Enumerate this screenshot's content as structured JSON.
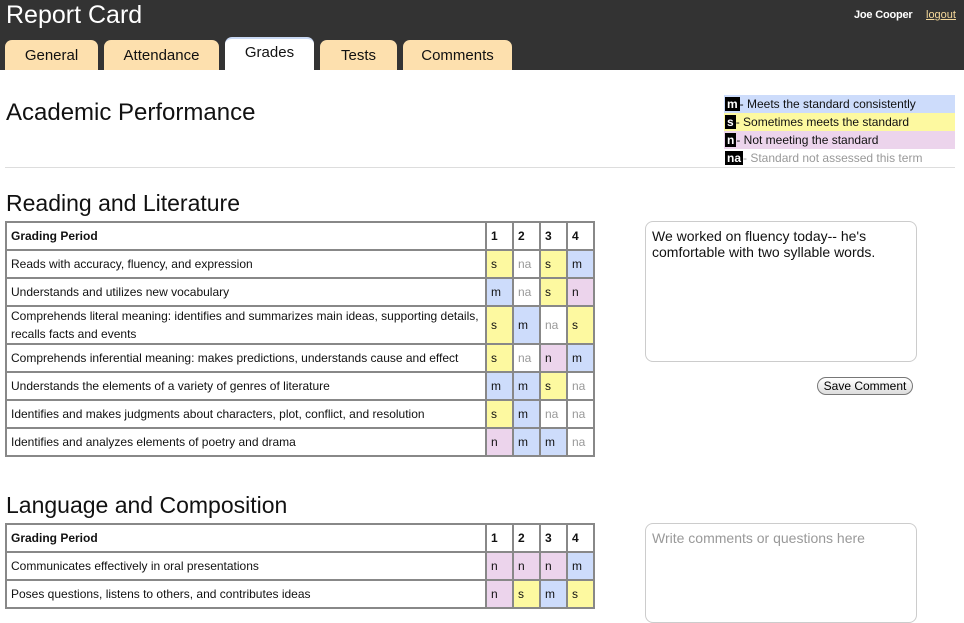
{
  "app": {
    "title": "Report Card",
    "user": "Joe Cooper",
    "logout": "logout"
  },
  "tabs": [
    {
      "label": "General",
      "w": 93
    },
    {
      "label": "Attendance",
      "w": 115
    },
    {
      "label": "Grades",
      "w": 89,
      "active": true
    },
    {
      "label": "Tests",
      "w": 77
    },
    {
      "label": "Comments",
      "w": 109
    }
  ],
  "page_title": "Academic Performance",
  "legend": [
    {
      "code": "m",
      "text": "- Meets the standard consistently",
      "color": "#cddcfb"
    },
    {
      "code": "s",
      "text": "- Sometimes meets the standard",
      "color": "#fdf9a0"
    },
    {
      "code": "n",
      "text": "- Not meeting the standard",
      "color": "#ecd4ec"
    },
    {
      "code": "na",
      "text": "- Standard not assessed this term",
      "color": "#ffffff"
    }
  ],
  "sections": [
    {
      "title": "Reading and Literature",
      "header": "Grading Period",
      "periods": [
        "1",
        "2",
        "3",
        "4"
      ],
      "rows": [
        {
          "label": "Reads with accuracy, fluency, and expression",
          "grades": [
            "s",
            "na",
            "s",
            "m"
          ]
        },
        {
          "label": "Understands and utilizes new vocabulary",
          "grades": [
            "m",
            "na",
            "s",
            "n"
          ]
        },
        {
          "label": "Comprehends literal meaning: identifies and summarizes main ideas, supporting details, recalls facts and events",
          "grades": [
            "s",
            "m",
            "na",
            "s"
          ]
        },
        {
          "label": "Comprehends inferential meaning: makes predictions, understands cause and effect",
          "grades": [
            "s",
            "na",
            "n",
            "m"
          ]
        },
        {
          "label": "Understands the elements of a variety of genres of literature",
          "grades": [
            "m",
            "m",
            "s",
            "na"
          ]
        },
        {
          "label": "Identifies and makes judgments about characters, plot, conflict, and resolution",
          "grades": [
            "s",
            "m",
            "na",
            "na"
          ]
        },
        {
          "label": "Identifies and analyzes elements of poetry and drama",
          "grades": [
            "n",
            "m",
            "m",
            "na"
          ]
        }
      ],
      "comment": "We worked on fluency today-- he's comfortable with two syllable words.",
      "comment_placeholder": "",
      "save_label": "Save Comment"
    },
    {
      "title": "Language and Composition",
      "header": "Grading Period",
      "periods": [
        "1",
        "2",
        "3",
        "4"
      ],
      "rows": [
        {
          "label": "Communicates effectively in oral presentations",
          "grades": [
            "n",
            "n",
            "n",
            "m"
          ]
        },
        {
          "label": "Poses questions, listens to others, and contributes ideas",
          "grades": [
            "n",
            "s",
            "m",
            "s"
          ]
        }
      ],
      "comment": "",
      "comment_placeholder": "Write comments or questions here"
    }
  ]
}
